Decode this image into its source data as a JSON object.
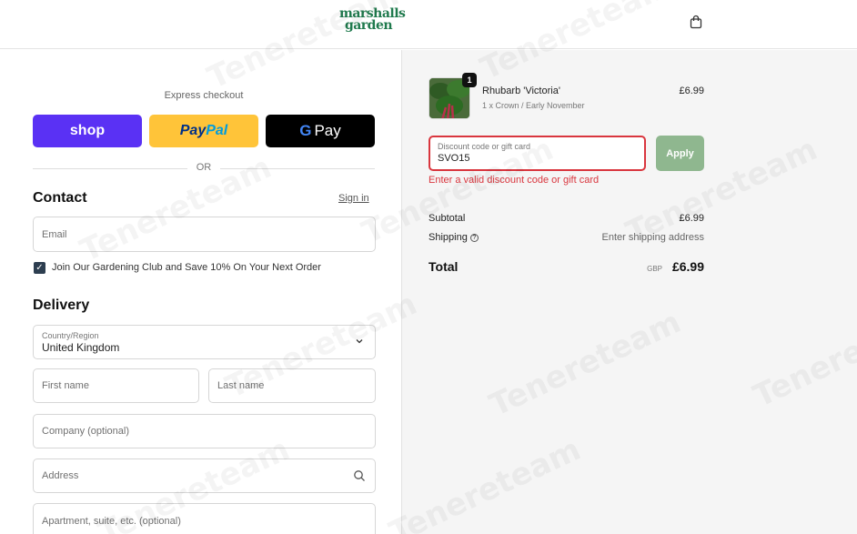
{
  "header": {
    "logo_line1": "marshalls",
    "logo_line2": "garden",
    "cart_icon": "shopping-bag-icon"
  },
  "express": {
    "label": "Express checkout",
    "shop_label": "shop",
    "paypal_label_a": "Pay",
    "paypal_label_b": "Pal",
    "gpay_g": "G",
    "gpay_label": "Pay",
    "or_label": "OR"
  },
  "contact": {
    "heading": "Contact",
    "signin_label": "Sign in",
    "email_placeholder": "Email",
    "newsletter_label": "Join Our Gardening Club and Save 10% On Your Next Order",
    "newsletter_checked": true
  },
  "delivery": {
    "heading": "Delivery",
    "country_label": "Country/Region",
    "country_value": "United Kingdom",
    "first_name_placeholder": "First name",
    "last_name_placeholder": "Last name",
    "company_placeholder": "Company (optional)",
    "address_placeholder": "Address",
    "apartment_placeholder": "Apartment, suite, etc. (optional)"
  },
  "order": {
    "item": {
      "name": "Rhubarb 'Victoria'",
      "variant": "1 x Crown / Early November",
      "price": "£6.99",
      "quantity": "1"
    },
    "discount_label": "Discount code or gift card",
    "discount_value": "SVO15",
    "apply_label": "Apply",
    "error_message": "Enter a valid discount code or gift card",
    "subtotal_label": "Subtotal",
    "subtotal_value": "£6.99",
    "shipping_label": "Shipping",
    "shipping_value": "Enter shipping address",
    "total_label": "Total",
    "currency": "GBP",
    "total_value": "£6.99"
  },
  "colors": {
    "brand": "#1f7a4d",
    "shop": "#5a31f4",
    "paypal": "#ffc439",
    "error": "#d9363e",
    "apply": "#8fb78f"
  },
  "watermark": "Tenereteam"
}
